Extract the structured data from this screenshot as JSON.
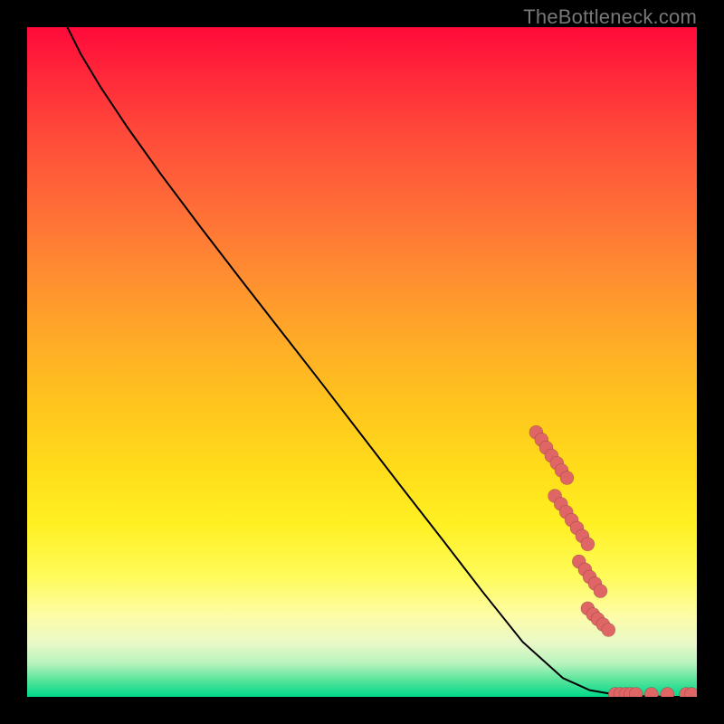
{
  "watermark": "TheBottleneck.com",
  "colors": {
    "background": "#000000",
    "curve": "#000000",
    "dot_fill": "#e06666",
    "gradient_stops": [
      "#ff0a3a",
      "#ff6a38",
      "#ffc41e",
      "#fffb5a",
      "#e9f9c8",
      "#00d98a"
    ]
  },
  "chart_data": {
    "type": "line",
    "title": "",
    "xlabel": "",
    "ylabel": "",
    "xlim": [
      0,
      100
    ],
    "ylim": [
      0,
      100
    ],
    "grid": false,
    "legend": false,
    "curve_points_normalized": [
      [
        0.06,
        0.0
      ],
      [
        0.08,
        0.04
      ],
      [
        0.11,
        0.09
      ],
      [
        0.15,
        0.15
      ],
      [
        0.2,
        0.22
      ],
      [
        0.26,
        0.3
      ],
      [
        0.32,
        0.378
      ],
      [
        0.38,
        0.455
      ],
      [
        0.44,
        0.532
      ],
      [
        0.5,
        0.61
      ],
      [
        0.56,
        0.688
      ],
      [
        0.62,
        0.765
      ],
      [
        0.68,
        0.843
      ],
      [
        0.74,
        0.918
      ],
      [
        0.8,
        0.972
      ],
      [
        0.84,
        0.99
      ],
      [
        0.88,
        0.997
      ],
      [
        0.92,
        0.999
      ],
      [
        0.96,
        1.0
      ],
      [
        1.0,
        1.0
      ]
    ],
    "series": [
      {
        "name": "scatter-on-curve",
        "points_normalized": [
          [
            0.76,
            0.605
          ],
          [
            0.768,
            0.616
          ],
          [
            0.775,
            0.628
          ],
          [
            0.783,
            0.64
          ],
          [
            0.791,
            0.651
          ],
          [
            0.798,
            0.662
          ],
          [
            0.806,
            0.673
          ],
          [
            0.788,
            0.7
          ],
          [
            0.797,
            0.712
          ],
          [
            0.805,
            0.724
          ],
          [
            0.813,
            0.736
          ],
          [
            0.821,
            0.748
          ],
          [
            0.829,
            0.76
          ],
          [
            0.837,
            0.772
          ],
          [
            0.824,
            0.798
          ],
          [
            0.833,
            0.81
          ],
          [
            0.84,
            0.821
          ],
          [
            0.848,
            0.831
          ],
          [
            0.856,
            0.842
          ],
          [
            0.837,
            0.868
          ],
          [
            0.845,
            0.877
          ],
          [
            0.852,
            0.884
          ],
          [
            0.86,
            0.892
          ],
          [
            0.868,
            0.9
          ]
        ]
      },
      {
        "name": "scatter-bottom",
        "points_normalized": [
          [
            0.878,
            0.996
          ],
          [
            0.886,
            0.996
          ],
          [
            0.894,
            0.996
          ],
          [
            0.901,
            0.996
          ],
          [
            0.909,
            0.996
          ],
          [
            0.932,
            0.996
          ],
          [
            0.956,
            0.996
          ],
          [
            0.984,
            0.996
          ],
          [
            0.992,
            0.996
          ]
        ]
      }
    ]
  }
}
